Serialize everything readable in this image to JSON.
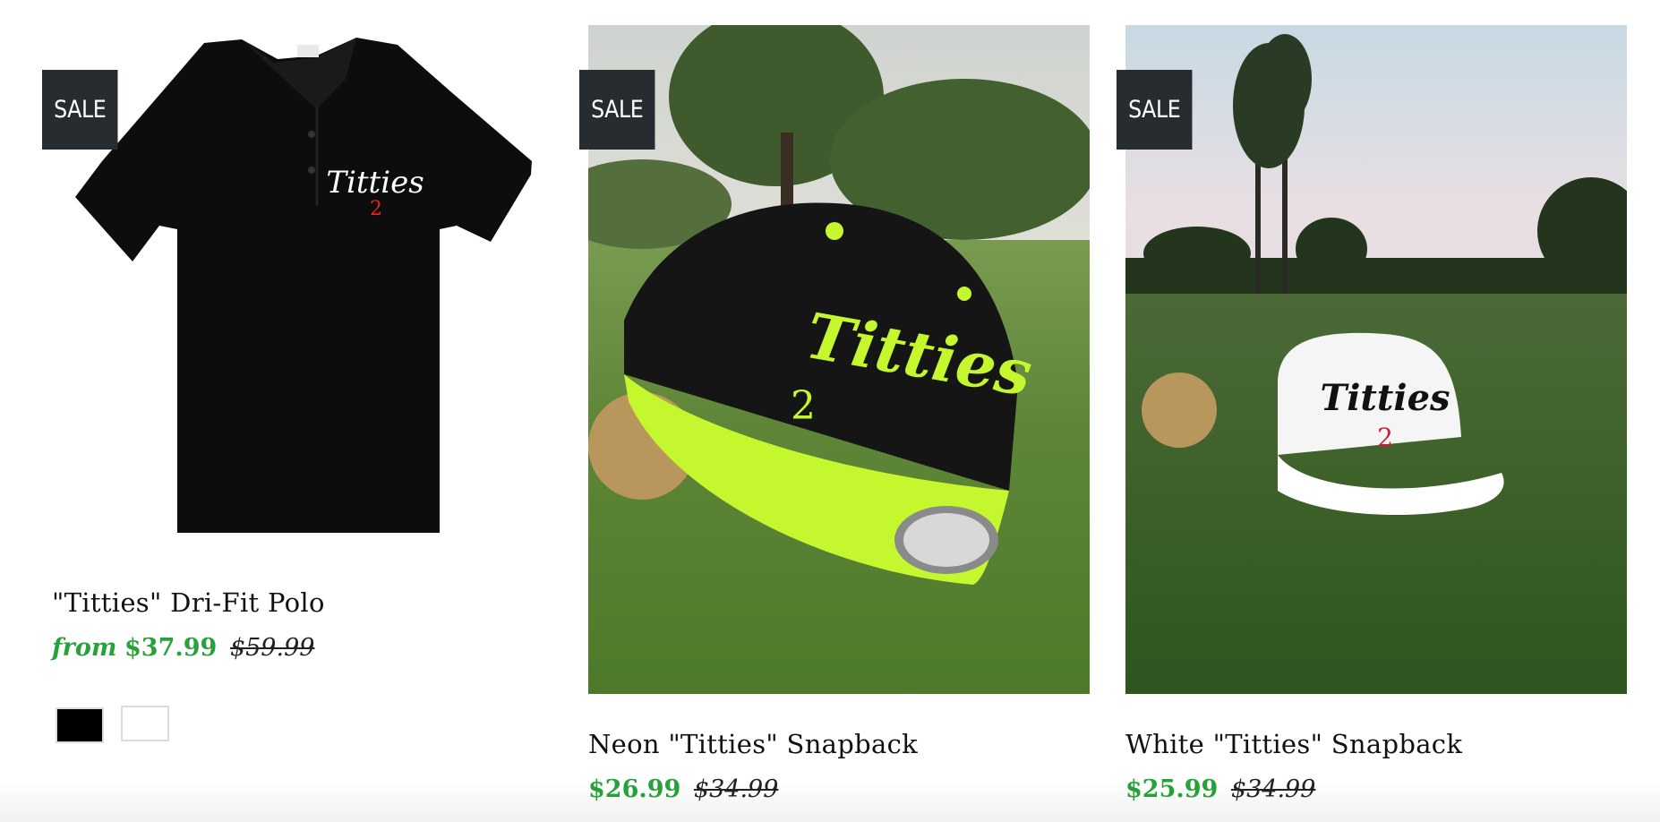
{
  "badges": {
    "sale_label": "SALE"
  },
  "products": [
    {
      "title": "\"Titties\" Dri-Fit Polo",
      "price_prefix": "from",
      "price": "$37.99",
      "compare_at": "$59.99",
      "image_text": "Titties",
      "image_number": "2",
      "swatches": [
        "#000000",
        "#ffffff"
      ]
    },
    {
      "title": "Neon \"Titties\" Snapback",
      "price": "$26.99",
      "compare_at": "$34.99",
      "image_text": "Titties",
      "image_number": "2"
    },
    {
      "title": "White \"Titties\" Snapback",
      "price": "$25.99",
      "compare_at": "$34.99",
      "image_text": "Titties",
      "image_number": "2"
    }
  ],
  "colors": {
    "accent_green": "#27a23a",
    "badge_bg": "#272c31",
    "neon": "#c4f72e"
  }
}
